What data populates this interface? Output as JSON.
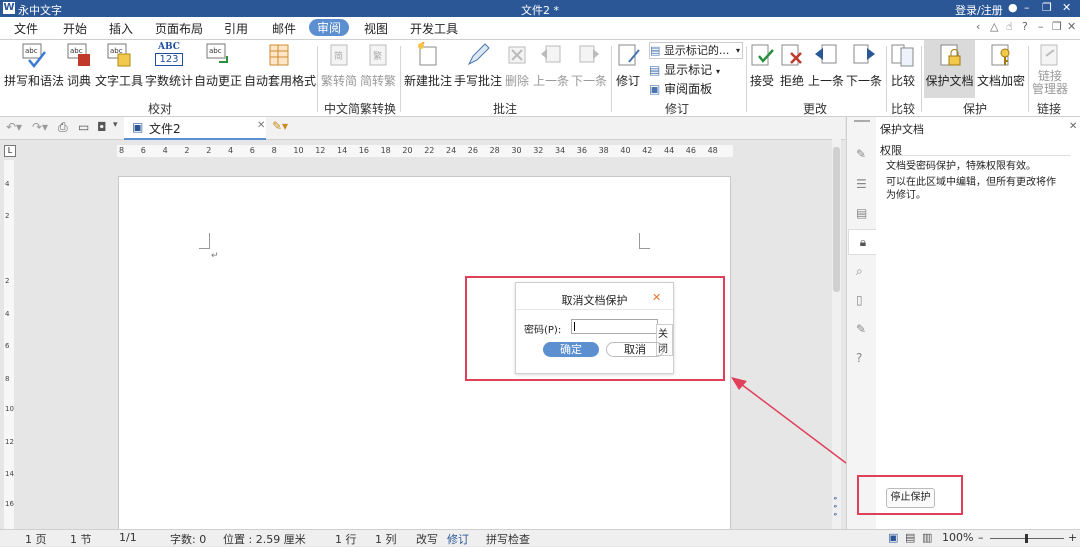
{
  "titlebar": {
    "app_name": "永中文字",
    "doc_title": "文件2 *",
    "login": "登录/注册"
  },
  "menu": [
    "文件",
    "开始",
    "插入",
    "页面布局",
    "引用",
    "邮件",
    "审阅",
    "视图",
    "开发工具"
  ],
  "ribbon": {
    "proofing": {
      "spell": "拼写和语法",
      "dictionary": "词典",
      "text_tools": "文字工具",
      "word_count": "字数统计",
      "autocorrect": "自动更正",
      "autoformat": "自动套用格式",
      "group": "校对"
    },
    "chinese": {
      "trad_to_simp": "繁转简",
      "simp_to_trad": "简转繁",
      "group": "中文简繁转换"
    },
    "comments": {
      "new": "新建批注",
      "handwrite": "手写批注",
      "delete": "删除",
      "prev": "上一条",
      "next": "下一条",
      "group": "批注"
    },
    "tracking": {
      "track": "修订",
      "show_markup_select": "显示标记的...",
      "show_markup": "显示标记",
      "review_pane": "审阅面板",
      "group": "修订"
    },
    "changes": {
      "accept": "接受",
      "reject": "拒绝",
      "prev": "上一条",
      "next": "下一条",
      "group": "更改"
    },
    "compare": {
      "compare": "比较",
      "group": "比较"
    },
    "protect": {
      "protect_doc": "保护文档",
      "encrypt": "文档加密",
      "group": "保护"
    },
    "links": {
      "manager_line1": "链接",
      "manager_line2": "管理器",
      "group": "链接"
    },
    "abc_badge": "ABC",
    "num_badge": "123"
  },
  "doc_tab": {
    "name": "文件2"
  },
  "ruler": {
    "h_ticks": [
      "8",
      "6",
      "4",
      "2",
      "2",
      "4",
      "6",
      "8",
      "10",
      "12",
      "14",
      "16",
      "18",
      "20",
      "22",
      "24",
      "26",
      "28",
      "30",
      "32",
      "34",
      "36",
      "38",
      "40",
      "42",
      "44",
      "46",
      "48"
    ],
    "v_ticks": [
      "4",
      "2",
      "2",
      "4",
      "6",
      "8",
      "10",
      "12",
      "14",
      "16"
    ]
  },
  "side_panel": {
    "title": "保护文档",
    "section": "权限",
    "line1": "文档受密码保护，特殊权限有效。",
    "line2a": "可以在此区域中编辑，但所有更改将作",
    "line2b": "为修订。",
    "stop_button": "停止保护"
  },
  "dialog": {
    "title": "取消文档保护",
    "password_label": "密码(P):",
    "close_tooltip": "关闭",
    "ok": "确定",
    "cancel": "取消"
  },
  "status": {
    "page": "1 页",
    "section": "1 节",
    "page_of": "1/1",
    "words": "字数: 0",
    "position": "位置 : 2.59 厘米",
    "line": "1 行",
    "column": "1 列",
    "overwrite": "改写",
    "track": "修订",
    "spell": "拼写检查",
    "zoom": "100%"
  },
  "colors": {
    "title_bg": "#2b5797",
    "accent": "#5b8fd0",
    "highlight": "#e0405a"
  }
}
